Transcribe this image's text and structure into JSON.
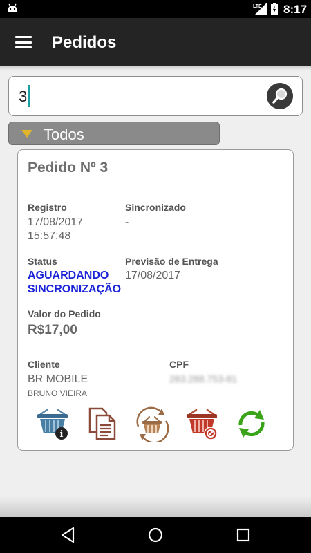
{
  "status_bar": {
    "time": "8:17",
    "network_label": "LTE",
    "icons": [
      "android-icon",
      "lte-signal-icon",
      "battery-icon"
    ]
  },
  "app_bar": {
    "title": "Pedidos",
    "menu_icon": "hamburger-menu-icon"
  },
  "search": {
    "value": "3",
    "button_icon": "search-icon"
  },
  "filter": {
    "label": "Todos",
    "icon": "triangle-down-icon"
  },
  "order": {
    "title": "Pedido Nº 3",
    "registro_label": "Registro",
    "registro_date": "17/08/2017",
    "registro_time": "15:57:48",
    "sincronizado_label": "Sincronizado",
    "sincronizado_value": "-",
    "status_label": "Status",
    "status_line1": "AGUARDANDO",
    "status_line2": "SINCRONIZAÇÃO",
    "previsao_label": "Previsão de Entrega",
    "previsao_value": "17/08/2017",
    "valor_label": "Valor do Pedido",
    "valor_value": "R$17,00",
    "cliente_label": "Cliente",
    "cliente_name": "BR MOBILE",
    "cliente_contact": "BRUNO VIEIRA",
    "cpf_label": "CPF",
    "cpf_value": "283.288.753-81",
    "actions": [
      "basket-info-icon",
      "copy-document-icon",
      "basket-sync-icon",
      "basket-cancel-icon",
      "refresh-icon"
    ]
  },
  "colors": {
    "app_bar": "#242424",
    "status_text": "#1a23d6",
    "filter_bar": "#8a8a8a",
    "filter_arrow": "#e0b52a",
    "refresh_green": "#3aa31a",
    "cancel_red": "#c0392b"
  },
  "nav": {
    "icons": [
      "back-icon",
      "home-icon",
      "recents-icon"
    ]
  }
}
